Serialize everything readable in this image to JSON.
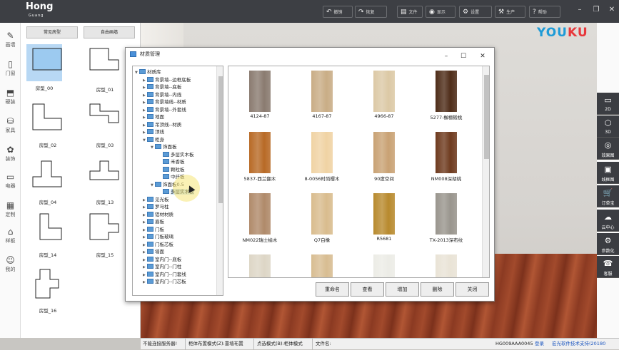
{
  "app": {
    "logo_main": "Hong",
    "logo_sub": "Guang"
  },
  "toolbar": [
    {
      "icon": "↶",
      "label": "撤销",
      "name": "undo"
    },
    {
      "icon": "↷",
      "label": "恢复",
      "name": "redo"
    },
    {
      "icon": "▤",
      "label": "文件",
      "name": "file"
    },
    {
      "icon": "◉",
      "label": "显示",
      "name": "display"
    },
    {
      "icon": "⚙",
      "label": "设置",
      "name": "settings"
    },
    {
      "icon": "⚒",
      "label": "生产",
      "name": "production"
    },
    {
      "icon": "?",
      "label": "帮助",
      "name": "help"
    }
  ],
  "leftbar": [
    {
      "icon": "✎",
      "label": "画墙"
    },
    {
      "icon": "▯",
      "label": "门窗"
    },
    {
      "icon": "⬒",
      "label": "硬装"
    },
    {
      "icon": "⛁",
      "label": "家具"
    },
    {
      "icon": "✿",
      "label": "装饰"
    },
    {
      "icon": "▭",
      "label": "电器"
    },
    {
      "icon": "▦",
      "label": "定制"
    },
    {
      "icon": "⌂",
      "label": "样板"
    },
    {
      "icon": "☺",
      "label": "我的"
    }
  ],
  "panel": {
    "tab_common": "常见房型",
    "tab_free": "自由画墙",
    "shapes": [
      "房型_00",
      "房型_01",
      "房型_02",
      "房型_03",
      "房型_04",
      "房型_13",
      "房型_14",
      "房型_15",
      "房型_16"
    ]
  },
  "watermark": {
    "you": "YOU",
    "ku": "KU"
  },
  "rightbar": [
    {
      "icon": "▭",
      "label": "2D"
    },
    {
      "icon": "⬡",
      "label": "3D"
    },
    {
      "icon": "◎",
      "label": "效果图"
    },
    {
      "icon": "▣",
      "label": "线框图"
    },
    {
      "icon": "🛒",
      "label": "订单宝"
    },
    {
      "icon": "☁",
      "label": "云中心"
    },
    {
      "icon": "⚙",
      "label": "参数化"
    },
    {
      "icon": "☎",
      "label": "客服"
    }
  ],
  "dialog": {
    "title": "材质管理",
    "tree": [
      {
        "label": "材质库",
        "level": 0,
        "open": true
      },
      {
        "label": "背景墙--边框底板",
        "level": 1
      },
      {
        "label": "背景墙--底板",
        "level": 1
      },
      {
        "label": "背景墙--内线",
        "level": 1
      },
      {
        "label": "背景墙线--材质",
        "level": 1
      },
      {
        "label": "背景墙--外套线",
        "level": 1
      },
      {
        "label": "地面",
        "level": 1
      },
      {
        "label": "吊顶线--材质",
        "level": 1
      },
      {
        "label": "顶线",
        "level": 1
      },
      {
        "label": "柜身",
        "level": 1,
        "open": true
      },
      {
        "label": "饰面板",
        "level": 2,
        "open": true
      },
      {
        "label": "多层实木板",
        "level": 3
      },
      {
        "label": "禾香板",
        "level": 3
      },
      {
        "label": "颗粒板",
        "level": 3
      },
      {
        "label": "中纤板",
        "level": 3
      },
      {
        "label": "饰面板0.5",
        "level": 2,
        "open": true
      },
      {
        "label": "多层实木板",
        "level": 3,
        "selected": true
      },
      {
        "label": "见光板",
        "level": 1
      },
      {
        "label": "罗马柱",
        "level": 1
      },
      {
        "label": "铝材材质",
        "level": 1
      },
      {
        "label": "眉板",
        "level": 1
      },
      {
        "label": "门板",
        "level": 1
      },
      {
        "label": "门板玻璃",
        "level": 1
      },
      {
        "label": "门板芯板",
        "level": 1
      },
      {
        "label": "墙面",
        "level": 1
      },
      {
        "label": "室内门--底板",
        "level": 1
      },
      {
        "label": "室内门--门柱",
        "level": 1
      },
      {
        "label": "室内门--门套线",
        "level": 1
      },
      {
        "label": "室内门--门芯板",
        "level": 1
      }
    ],
    "materials": [
      {
        "name": "4124-87",
        "color": "#8a7b70"
      },
      {
        "name": "4167-87",
        "color": "#c9ad86"
      },
      {
        "name": "4966-87",
        "color": "#dcc9a6"
      },
      {
        "name": "5277-檞檀椴桃",
        "color": "#4e2c18"
      },
      {
        "name": "5837-西兰翻木",
        "color": "#b86a26"
      },
      {
        "name": "8-0056时尚樱木",
        "color": "#f0d3a4"
      },
      {
        "name": "90度空间",
        "color": "#c9a274"
      },
      {
        "name": "NM008深胡桃",
        "color": "#6e3a1e"
      },
      {
        "name": "NM022瑞士榆木",
        "color": "#b08a6a"
      },
      {
        "name": "Q7白橡",
        "color": "#d9bc8e"
      },
      {
        "name": "R5681",
        "color": "#b88a2e"
      },
      {
        "name": "TX-2013深布纹",
        "color": "#99958d"
      },
      {
        "name": "",
        "color": "#ddd6c6"
      },
      {
        "name": "",
        "color": "#d8bd92"
      },
      {
        "name": "",
        "color": "#ecece6"
      },
      {
        "name": "",
        "color": "#e9e3d6"
      }
    ],
    "buttons": [
      "重命名",
      "查看",
      "增加",
      "删除",
      "关闭"
    ]
  },
  "status": {
    "server": "不能连接服务器!",
    "mode1": "柜体布置模式(Z):靠墙布置",
    "mode2": "点选模式(B):柜体模式",
    "filename_label": "文件名:",
    "code": "HG009AAA0045",
    "login": "登录",
    "support": "宏光软件技术支持(20180"
  }
}
